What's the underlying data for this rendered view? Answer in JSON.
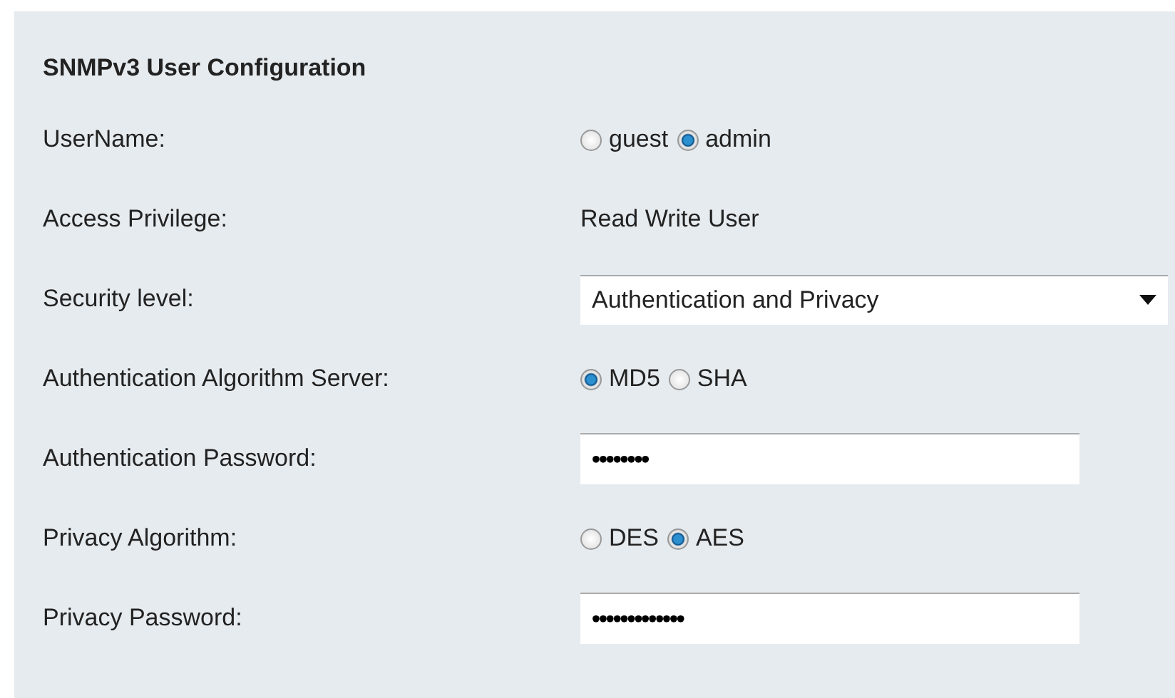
{
  "title": "SNMPv3 User Configuration",
  "rows": [
    {
      "label": "UserName:",
      "kind": "radio",
      "options": [
        {
          "label": "guest",
          "selected": false
        },
        {
          "label": "admin",
          "selected": true
        }
      ]
    },
    {
      "label": "Access Privilege:",
      "kind": "text",
      "value": "Read Write User"
    },
    {
      "label": "Security level:",
      "kind": "select",
      "value": "Authentication and Privacy"
    },
    {
      "label": "Authentication Algorithm Server:",
      "kind": "radio",
      "options": [
        {
          "label": "MD5",
          "selected": true
        },
        {
          "label": "SHA",
          "selected": false
        }
      ]
    },
    {
      "label": "Authentication Password:",
      "kind": "password",
      "value": "••••••••"
    },
    {
      "label": "Privacy Algorithm:",
      "kind": "radio",
      "options": [
        {
          "label": "DES",
          "selected": false
        },
        {
          "label": "AES",
          "selected": true
        }
      ]
    },
    {
      "label": "Privacy Password:",
      "kind": "password",
      "value": "•••••••••••••"
    }
  ]
}
